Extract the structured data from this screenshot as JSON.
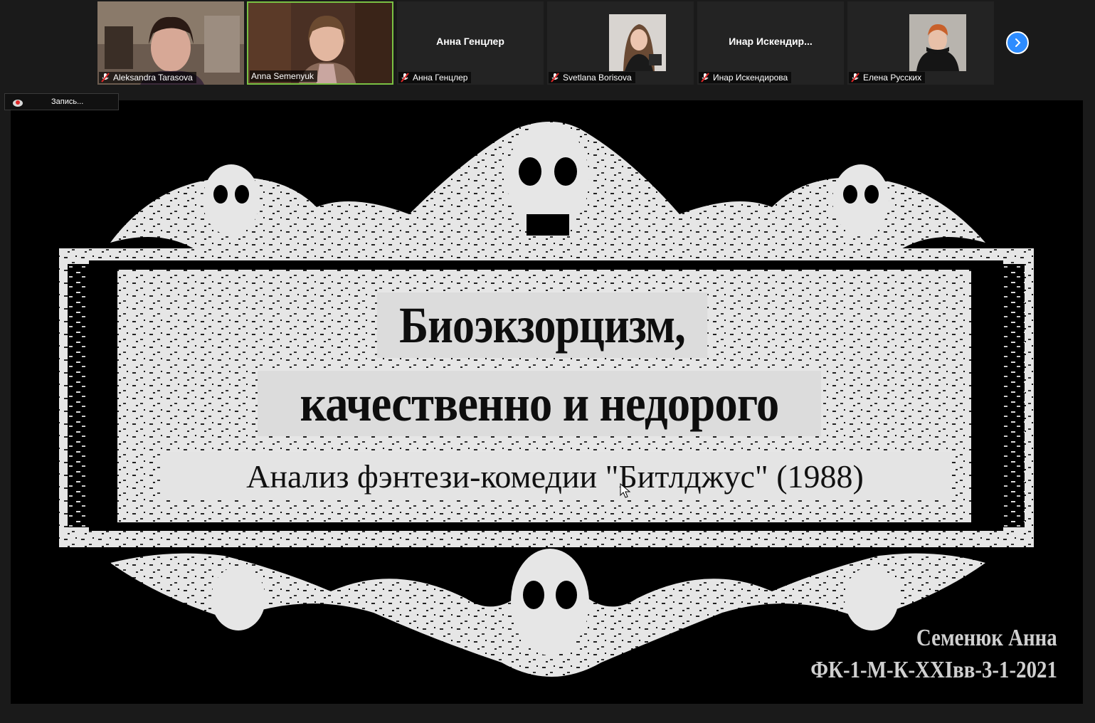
{
  "participants": [
    {
      "name": "Aleksandra Tarasova",
      "muted": true,
      "video": true
    },
    {
      "name": "Anna Semenyuk",
      "muted": false,
      "video": true,
      "active": true
    },
    {
      "name": "Анна Генцлер",
      "display_name": "Анна Генцлер",
      "muted": true,
      "video": false
    },
    {
      "name": "Svetlana Borisova",
      "muted": true,
      "video": false,
      "avatar": true
    },
    {
      "name": "Инар Искендирова",
      "display_name": "Инар  Искендир...",
      "muted": true,
      "video": false
    },
    {
      "name": "Елена Русских",
      "muted": true,
      "video": false,
      "avatar": true
    }
  ],
  "next_page_icon": "chevron-right-icon",
  "recording": {
    "label": "Запись..."
  },
  "slide": {
    "title_line1": "Биоэкзорцизм,",
    "title_line2": "качественно и недорого",
    "subtitle": "Анализ фэнтези-комедии \"Битлджус\" (1988)",
    "author": "Семенюк Анна",
    "group": "ФК-1-М-К-XXIвв-3-1-2021"
  },
  "colors": {
    "accent": "#2d8cff",
    "active_border": "#7ac143",
    "mute": "#e02828"
  }
}
